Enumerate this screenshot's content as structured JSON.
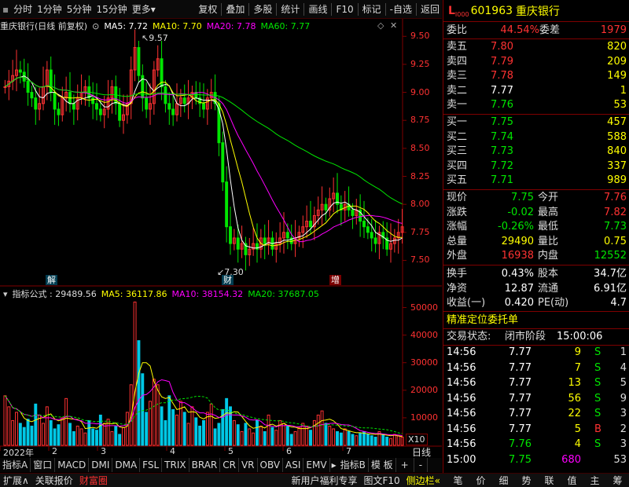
{
  "toolbar": {
    "items": [
      "分时",
      "1分钟",
      "5分钟",
      "15分钟",
      "更多",
      "复权",
      "叠加",
      "多股",
      "统计",
      "画线",
      "F10",
      "标记",
      "-自选",
      "返回"
    ]
  },
  "main_legend": {
    "title": "重庆银行(日线 前复权)",
    "ma5_label": "MA5:",
    "ma5": "7.72",
    "ma10_label": "MA10:",
    "ma10": "7.70",
    "ma20_label": "MA20:",
    "ma20": "7.78",
    "ma60_label": "MA60:",
    "ma60": "7.77"
  },
  "sub_legend": {
    "title": "指标公式 :",
    "value": "29489.56",
    "ma5_label": "MA5:",
    "ma5": "36117.86",
    "ma10_label": "MA10:",
    "ma10": "38154.32",
    "ma20_label": "MA20:",
    "ma20": "37687.05"
  },
  "price_axis": [
    "9.50",
    "9.25",
    "9.00",
    "8.75",
    "8.50",
    "8.25",
    "8.00",
    "7.75",
    "7.50"
  ],
  "vol_axis": [
    "50000",
    "40000",
    "30000",
    "20000",
    "10000"
  ],
  "vol_unit": "X10",
  "high_marker": "9.57",
  "low_marker": "7.30",
  "event_tags": [
    "解",
    "财",
    "增"
  ],
  "time_axis": [
    "2022年",
    "2",
    "3",
    "4",
    "5",
    "6",
    "7"
  ],
  "period": "日线",
  "indicator_tabs": [
    "指标A",
    "窗口",
    "MACD",
    "DMI",
    "DMA",
    "FSL",
    "TRIX",
    "BRAR",
    "CR",
    "VR",
    "OBV",
    "ASI",
    "EMV",
    "指标B",
    "模 板",
    "+",
    "-"
  ],
  "bottom_tabs": [
    "扩展∧",
    "关联报价",
    "财富圈",
    "新用户福利专享",
    "图文F10",
    "侧边栏«"
  ],
  "right_tabs": [
    "笔",
    "价",
    "细",
    "势",
    "联",
    "值",
    "主",
    "筹"
  ],
  "quote": {
    "l_mark": "L",
    "level": "I000",
    "code": "601963",
    "name": "重庆银行",
    "wb_label": "委比",
    "wb": "44.54%",
    "wc_label": "委差",
    "wc": "1979",
    "asks": [
      {
        "label": "卖五",
        "price": "7.80",
        "vol": "820"
      },
      {
        "label": "卖四",
        "price": "7.79",
        "vol": "209"
      },
      {
        "label": "卖三",
        "price": "7.78",
        "vol": "149"
      },
      {
        "label": "卖二",
        "price": "7.77",
        "vol": "1"
      },
      {
        "label": "卖一",
        "price": "7.76",
        "vol": "53"
      }
    ],
    "bids": [
      {
        "label": "买一",
        "price": "7.75",
        "vol": "457"
      },
      {
        "label": "买二",
        "price": "7.74",
        "vol": "588"
      },
      {
        "label": "买三",
        "price": "7.73",
        "vol": "840"
      },
      {
        "label": "买四",
        "price": "7.72",
        "vol": "337"
      },
      {
        "label": "买五",
        "price": "7.71",
        "vol": "989"
      }
    ],
    "stats": [
      {
        "l1": "现价",
        "v1": "7.75",
        "l2": "今开",
        "v2": "7.76"
      },
      {
        "l1": "涨跌",
        "v1": "-0.02",
        "l2": "最高",
        "v2": "7.82"
      },
      {
        "l1": "涨幅",
        "v1": "-0.26%",
        "l2": "最低",
        "v2": "7.73"
      },
      {
        "l1": "总量",
        "v1": "29490",
        "l2": "量比",
        "v2": "0.75"
      },
      {
        "l1": "外盘",
        "v1": "16938",
        "l2": "内盘",
        "v2": "12552"
      }
    ],
    "stats2": [
      {
        "l1": "换手",
        "v1": "0.43%",
        "l2": "股本",
        "v2": "34.7亿"
      },
      {
        "l1": "净资",
        "v1": "12.87",
        "l2": "流通",
        "v2": "6.91亿"
      },
      {
        "l1": "收益(一)",
        "v1": "0.420",
        "l2": "PE(动)",
        "v2": "4.7"
      }
    ],
    "precise_order": "精准定位委托单",
    "trade_status_label": "交易状态:",
    "trade_status": "闭市阶段",
    "trade_time": "15:00:06",
    "ticks": [
      {
        "t": "14:56",
        "p": "7.77",
        "v": "9",
        "d": "S",
        "n": "1"
      },
      {
        "t": "14:56",
        "p": "7.77",
        "v": "7",
        "d": "S",
        "n": "4"
      },
      {
        "t": "14:56",
        "p": "7.77",
        "v": "13",
        "d": "S",
        "n": "5"
      },
      {
        "t": "14:56",
        "p": "7.77",
        "v": "56",
        "d": "S",
        "n": "9"
      },
      {
        "t": "14:56",
        "p": "7.77",
        "v": "22",
        "d": "S",
        "n": "3"
      },
      {
        "t": "14:56",
        "p": "7.77",
        "v": "5",
        "d": "B",
        "n": "2"
      },
      {
        "t": "14:56",
        "p": "7.76",
        "v": "4",
        "d": "S",
        "n": "3"
      },
      {
        "t": "15:00",
        "p": "7.75",
        "v": "680",
        "d": "",
        "n": "53"
      }
    ]
  },
  "colors": {
    "up": "#ff3232",
    "down": "#00e600",
    "ma5": "#ffffff",
    "ma10": "#ffff00",
    "ma20": "#ff00ff",
    "ma60": "#00e600",
    "vol_up": "#ff3232",
    "vol_down": "#00c8e6",
    "grid": "#7f0000"
  },
  "chart_data": {
    "type": "candlestick",
    "price_range": [
      7.3,
      9.6
    ],
    "closes": [
      9.05,
      9.1,
      9.15,
      9.2,
      9.18,
      9.1,
      9.0,
      8.95,
      8.85,
      8.9,
      9.05,
      9.2,
      9.0,
      8.85,
      8.8,
      8.95,
      9.0,
      8.9,
      8.85,
      8.95,
      9.0,
      9.05,
      8.95,
      8.9,
      8.85,
      8.8,
      8.85,
      8.95,
      9.05,
      8.9,
      8.75,
      8.8,
      8.9,
      9.2,
      9.4,
      9.15,
      8.95,
      8.85,
      8.9,
      9.2,
      9.3,
      9.05,
      8.9,
      8.85,
      8.8,
      8.9,
      8.95,
      8.9,
      8.95,
      9.0,
      8.95,
      8.9,
      8.85,
      8.95,
      9.0,
      8.9,
      8.55,
      8.2,
      7.8,
      7.65,
      7.7,
      7.6,
      7.65,
      7.55,
      7.6,
      7.65,
      7.6,
      7.7,
      7.65,
      7.7,
      7.6,
      7.65,
      7.7,
      7.75,
      7.7,
      7.65,
      7.7,
      7.75,
      7.8,
      7.85,
      7.8,
      7.9,
      7.95,
      8.0,
      7.95,
      8.05,
      8.1,
      8.0,
      7.95,
      8.0,
      7.95,
      7.9,
      7.95,
      7.85,
      7.8,
      7.75,
      7.7,
      7.65,
      7.75,
      7.7,
      7.6,
      7.65,
      7.7,
      7.75,
      7.8
    ],
    "volumes": [
      18000,
      14000,
      9000,
      12000,
      8000,
      6500,
      9500,
      7000,
      15000,
      11000,
      8000,
      14000,
      9000,
      6000,
      7500,
      10000,
      17000,
      8000,
      5000,
      7000,
      6000,
      4500,
      9000,
      6000,
      5500,
      11000,
      8000,
      9500,
      5000,
      7000,
      4000,
      6500,
      12000,
      22000,
      52000,
      38000,
      26000,
      12000,
      16000,
      24000,
      22000,
      14000,
      9000,
      18000,
      13000,
      11000,
      16000,
      12000,
      8000,
      14000,
      10000,
      7000,
      9000,
      12000,
      15000,
      6000,
      8000,
      13000,
      17000,
      14000,
      9000,
      7500,
      5000,
      8000,
      6000,
      4500,
      9000,
      7000,
      5000,
      11000,
      6500,
      5500,
      9000,
      8000,
      7000,
      4000,
      5000,
      6500,
      8000,
      7000,
      5500,
      9000,
      11000,
      12500,
      8000,
      7000,
      6000,
      5000,
      4500,
      6000,
      5000,
      4000,
      3500,
      4500,
      5000,
      4000,
      3500,
      3000,
      5000,
      4000,
      3000,
      2500,
      4000,
      3500,
      3000
    ]
  }
}
